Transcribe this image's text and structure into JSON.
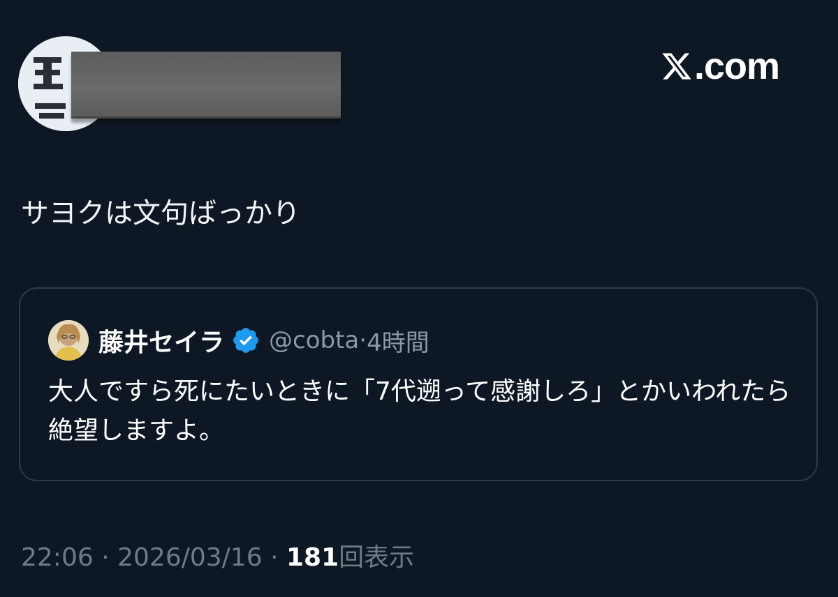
{
  "brand": {
    "label": ".com",
    "icon": "x-logo-icon"
  },
  "post": {
    "text": "サヨクは文句ばっかり",
    "footer": {
      "time": "22:06",
      "date": "2026/03/16",
      "separator": "·",
      "views_count": "181",
      "views_label": "回表示"
    }
  },
  "quote": {
    "author_name": "藤井セイラ",
    "verified": true,
    "handle": "@cobta",
    "separator": "·",
    "time_ago": "4時間",
    "text": "大人ですら死にたいときに「7代遡って感謝しろ」とかいわれたら絶望しますよ。"
  },
  "colors": {
    "background": "#0e1824",
    "border": "#2f3a46",
    "muted_text": "#8b98a5",
    "verified_blue": "#1d9bf0"
  }
}
